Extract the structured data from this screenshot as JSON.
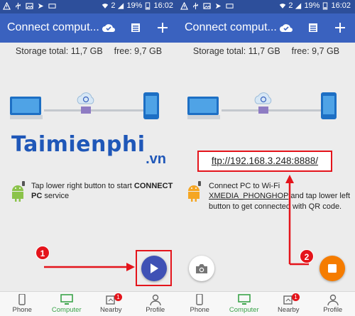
{
  "status": {
    "time": "16:02",
    "battery": "19%",
    "sim": "2"
  },
  "appbar": {
    "title": "Connect comput..."
  },
  "storage": {
    "total": "Storage total: 11,7 GB",
    "free": "free: 9,7 GB"
  },
  "logo": {
    "brand": "Taimienphi",
    "tld": ".vn"
  },
  "left": {
    "hint_text": "Tap lower right button to start ",
    "hint_bold1": "CONNECT",
    "hint_bold2": "PC",
    "hint_tail": " service"
  },
  "right": {
    "ftp_url": "ftp://192.168.3.248:8888/",
    "hint_text": "Connect PC to Wi-Fi",
    "network": "XMEDIA_PHONGHOP",
    "hint_tail": " and tap lower left button to get connected with QR code."
  },
  "markers": {
    "one": "1",
    "two": "2"
  },
  "nav": {
    "items": [
      {
        "label": "Phone",
        "icon": "phone-icon"
      },
      {
        "label": "Computer",
        "icon": "monitor-icon"
      },
      {
        "label": "Nearby",
        "icon": "nearby-icon",
        "badge": "1"
      },
      {
        "label": "Profile",
        "icon": "profile-icon"
      }
    ]
  },
  "colors": {
    "statusbar": "#2d4f9b",
    "appbar": "#3a62bf",
    "accent_green": "#3aa34a",
    "play": "#3f51b5",
    "stop": "#f57c00",
    "annotation": "#e4141b"
  }
}
